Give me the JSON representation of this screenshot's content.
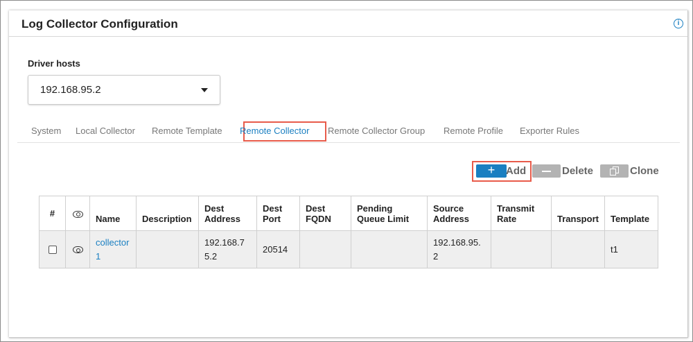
{
  "panel": {
    "title": "Log Collector Configuration",
    "info_icon": "info-icon"
  },
  "driver_hosts": {
    "label": "Driver hosts",
    "selected": "192.168.95.2"
  },
  "tabs": [
    {
      "label": "System"
    },
    {
      "label": "Local Collector"
    },
    {
      "label": "Remote Template"
    },
    {
      "label": "Remote Collector",
      "active": true
    },
    {
      "label": "Remote Collector Group"
    },
    {
      "label": "Remote Profile"
    },
    {
      "label": "Exporter Rules"
    }
  ],
  "toolbar": {
    "add_symbol": "+",
    "add_label": "Add",
    "delete_label": "Delete",
    "clone_label": "Clone"
  },
  "table": {
    "columns": {
      "hash": "#",
      "name": "Name",
      "description": "Description",
      "dest_address": "Dest Address",
      "dest_port": "Dest Port",
      "dest_fqdn": "Dest FQDN",
      "pending_queue_limit": "Pending Queue Limit",
      "source_address": "Source Address",
      "transmit_rate": "Transmit Rate",
      "transport": "Transport",
      "template": "Template"
    },
    "rows": [
      {
        "name": "collector1",
        "description": "",
        "dest_address": "192.168.75.2",
        "dest_port": "20514",
        "dest_fqdn": "",
        "pending_queue_limit": "",
        "source_address": "192.168.95.2",
        "transmit_rate": "",
        "transport": "",
        "template": "t1"
      }
    ]
  },
  "colors": {
    "accent": "#1a7fc1",
    "highlight": "#e85b4a",
    "disabled_button": "#b3b3b3"
  }
}
